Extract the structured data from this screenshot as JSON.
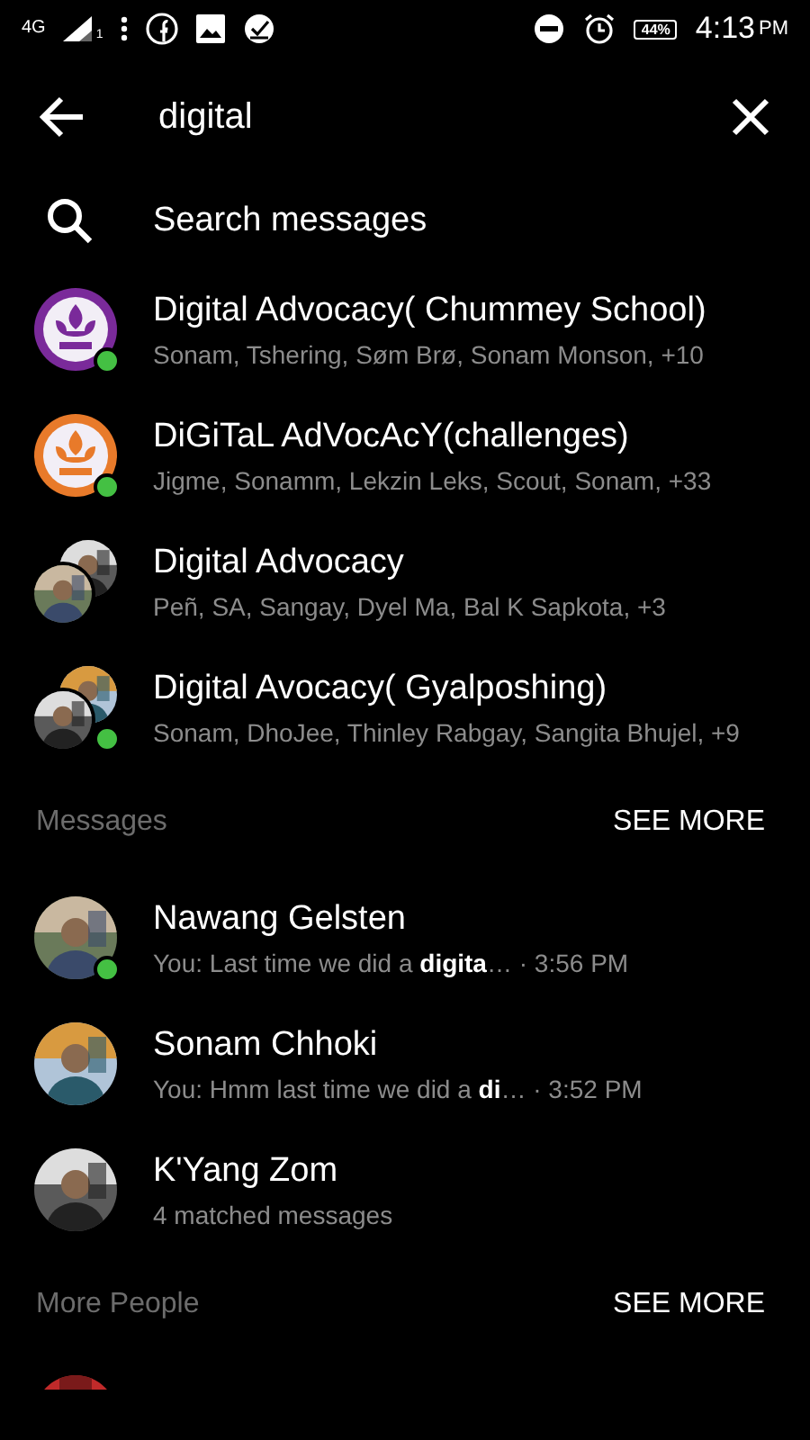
{
  "status_bar": {
    "network": "4G",
    "sim": "1",
    "battery": "44%",
    "time": "4:13",
    "ampm": "PM"
  },
  "search": {
    "value": "digital"
  },
  "search_messages": {
    "label": "Search messages"
  },
  "groups": [
    {
      "title": "Digital Advocacy( Chummey School)",
      "members": "Sonam, Tshering, Søm Brø, Sonam Monson, +10",
      "online": true,
      "kind": "emblem"
    },
    {
      "title": "DiGiTaL AdVocAcY(challenges)",
      "members": "Jigme, Sonamm, Lekzin Leks, Scout, Sonam, +33",
      "online": true,
      "kind": "emblem"
    },
    {
      "title": "Digital Advocacy",
      "members": "Peñ, SA, Sangay, Dyel Ma, Bal K Sapkota, +3",
      "online": false,
      "kind": "pair"
    },
    {
      "title": "Digital Avocacy( Gyalposhing)",
      "members": "Sonam, DhoJee, Thinley Rabgay, Sangita Bhujel, +9",
      "online": true,
      "kind": "pair"
    }
  ],
  "messages_section": {
    "title": "Messages",
    "action": "SEE MORE"
  },
  "messages": [
    {
      "name": "Nawang Gelsten",
      "snippet": "You: Last time we did a **digita**…",
      "time": "· 3:56 PM",
      "online": true
    },
    {
      "name": "Sonam Chhoki",
      "snippet": "You: Hmm last time we did a **di**…",
      "time": "· 3:52 PM",
      "online": false
    },
    {
      "name": "K'Yang Zom",
      "snippet": "4 matched messages",
      "online": false
    }
  ],
  "people_section": {
    "title": "More People",
    "action": "SEE MORE"
  }
}
